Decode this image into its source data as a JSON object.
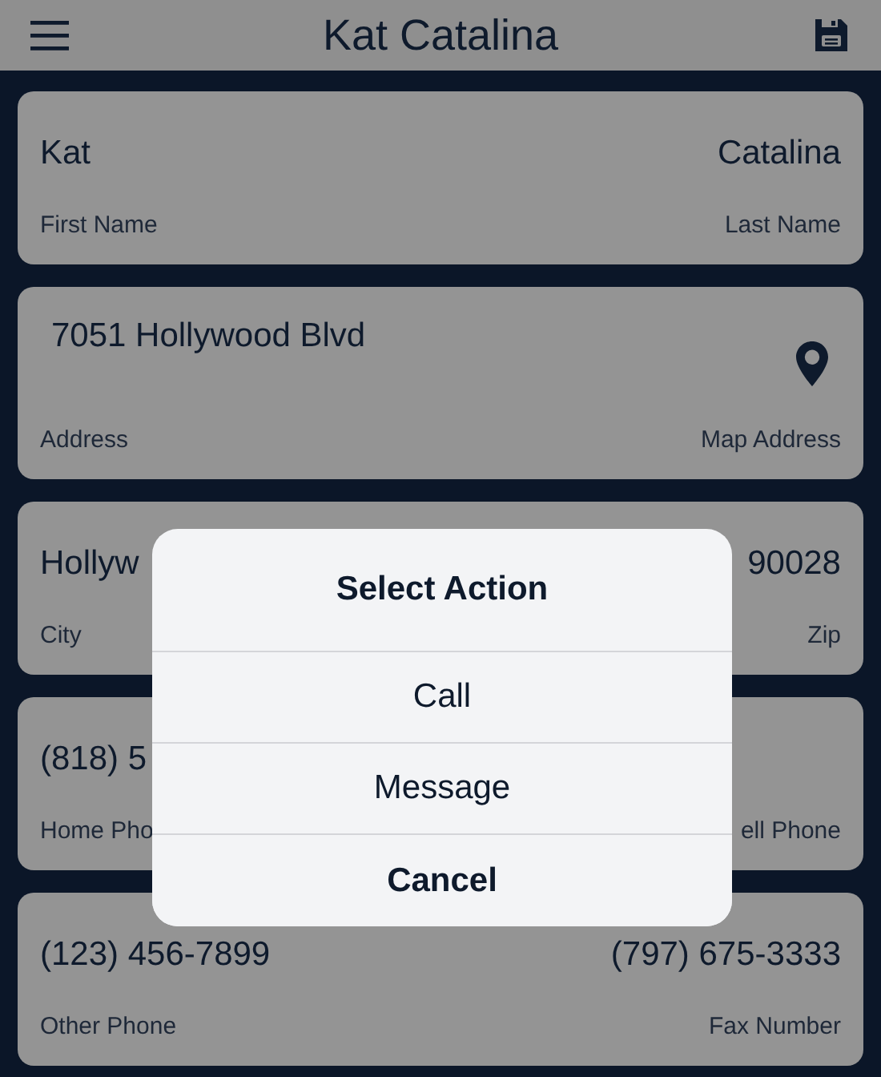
{
  "header": {
    "title": "Kat Catalina"
  },
  "cards": [
    {
      "kind": "pair",
      "left_value": "Kat",
      "right_value": "Catalina",
      "left_label": "First Name",
      "right_label": "Last Name"
    },
    {
      "kind": "map",
      "left_value": "7051 Hollywood Blvd",
      "left_label": "Address",
      "right_label": "Map Address"
    },
    {
      "kind": "pair",
      "left_value": "Hollyw",
      "right_value": "90028",
      "left_label": "City",
      "right_label": "Zip"
    },
    {
      "kind": "pair",
      "left_value": "(818) 5",
      "left_label": "Home Pho",
      "right_label": "ell Phone"
    },
    {
      "kind": "pair",
      "left_value": "(123) 456-7899",
      "right_value": "(797) 675-3333",
      "left_label": "Other Phone",
      "right_label": "Fax Number"
    }
  ],
  "dialog": {
    "title": "Select Action",
    "options": [
      {
        "label": "Call",
        "kind": "normal"
      },
      {
        "label": "Message",
        "kind": "normal"
      },
      {
        "label": "Cancel",
        "kind": "cancel"
      }
    ]
  }
}
